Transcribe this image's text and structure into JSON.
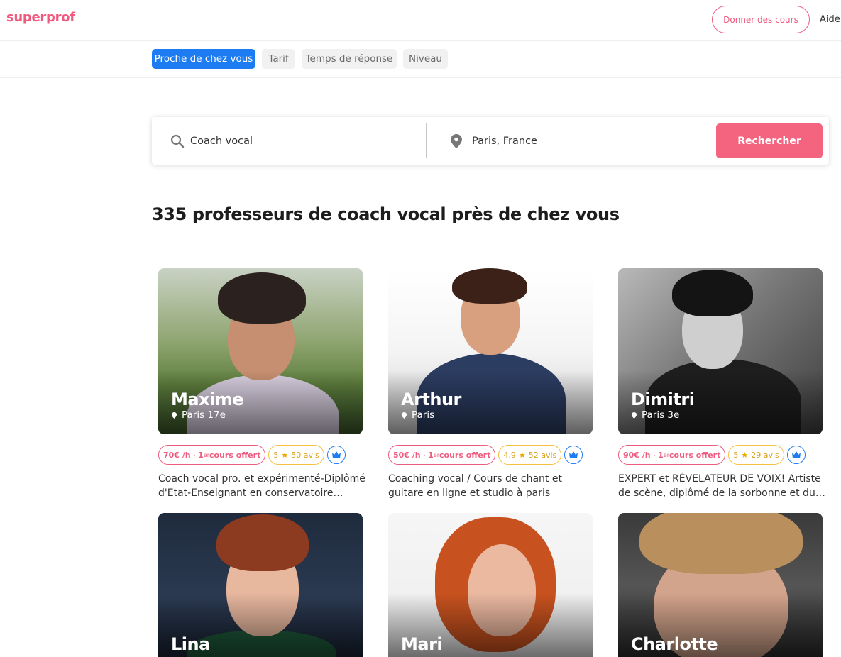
{
  "header": {
    "logo": "superprof",
    "give_lessons": "Donner des cours",
    "help": "Aide"
  },
  "filters": [
    {
      "label": "Proche de chez vous",
      "active": true
    },
    {
      "label": "Tarif",
      "active": false
    },
    {
      "label": "Temps de réponse",
      "active": false
    },
    {
      "label": "Niveau",
      "active": false
    }
  ],
  "search": {
    "subject": "Coach vocal",
    "location": "Paris, France",
    "button": "Rechercher"
  },
  "results_title": "335 professeurs de coach vocal près de chez vous",
  "cards": [
    {
      "name": "Maxime",
      "city": "Paris 17e",
      "price": "70€ /h",
      "offer_prefix": "1",
      "offer_sup": "er",
      "offer_suffix": " cours offert",
      "rating": "5",
      "reviews": "50 avis",
      "description": "Coach vocal pro. et expérimenté-Diplômé d'Etat-Enseignant en conservatoire…"
    },
    {
      "name": "Arthur",
      "city": "Paris",
      "price": "50€ /h",
      "offer_prefix": "1",
      "offer_sup": "er",
      "offer_suffix": " cours offert",
      "rating": "4.9",
      "reviews": "52 avis",
      "description": "Coaching vocal / Cours de chant et guitare en ligne et studio à paris"
    },
    {
      "name": "Dimitri",
      "city": "Paris 3e",
      "price": "90€ /h",
      "offer_prefix": "1",
      "offer_sup": "er",
      "offer_suffix": " cours offert",
      "rating": "5",
      "reviews": "29 avis",
      "description": "EXPERT et RÉVELATEUR DE VOIX! Artiste de scène, diplômé de la sorbonne et du…"
    },
    {
      "name": "Lina"
    },
    {
      "name": "Mari"
    },
    {
      "name": "Charlotte"
    }
  ],
  "colors": {
    "brand_pink": "#ef5b7f",
    "search_button": "#f4647f",
    "chip_active": "#1e7cf2",
    "rating_gold": "#f5c242"
  }
}
